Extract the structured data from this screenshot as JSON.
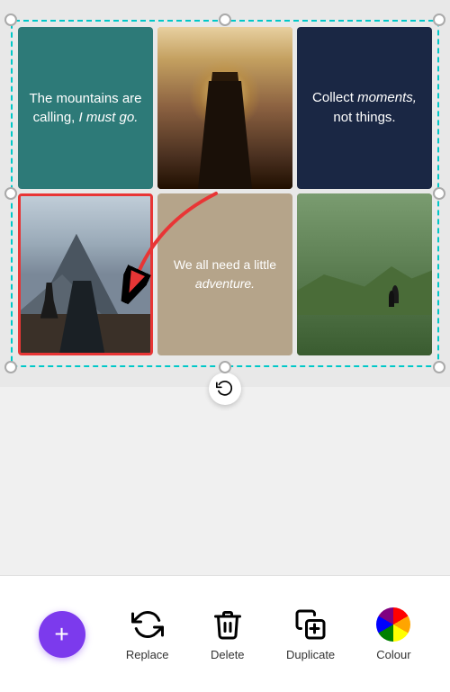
{
  "collage": {
    "cells": [
      {
        "id": "cell-1",
        "type": "text",
        "text": "The mountains are calling, I must go.",
        "italic_part": "I must go.",
        "bg": "#2d7a78"
      },
      {
        "id": "cell-2",
        "type": "photo",
        "description": "mountain view from above with legs"
      },
      {
        "id": "cell-3",
        "type": "text",
        "text": "Collect moments, not things.",
        "italic_part": "moments,",
        "bg": "#1a2744"
      },
      {
        "id": "cell-4",
        "type": "photo",
        "description": "person sitting on mountain",
        "selected": true
      },
      {
        "id": "cell-5",
        "type": "text",
        "text": "We all need a little adventure.",
        "italic_part": "adventure.",
        "bg": "#b5a48a"
      },
      {
        "id": "cell-6",
        "type": "photo",
        "description": "hill with silhouette of person"
      }
    ]
  },
  "toolbar": {
    "fab_label": "+",
    "items": [
      {
        "id": "replace",
        "label": "Replace"
      },
      {
        "id": "delete",
        "label": "Delete"
      },
      {
        "id": "duplicate",
        "label": "Duplicate"
      },
      {
        "id": "colour",
        "label": "Colour"
      }
    ]
  }
}
